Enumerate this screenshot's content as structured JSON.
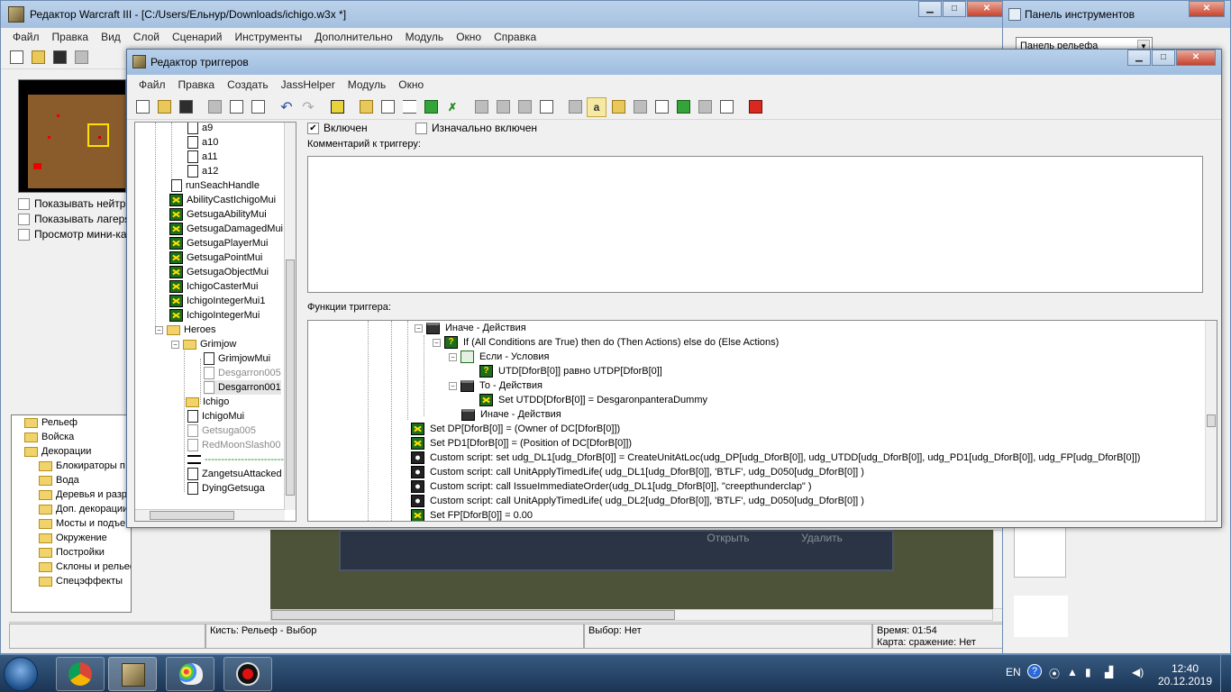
{
  "main_window": {
    "title": "Редактор Warcraft III  - [C:/Users/Ельнур/Downloads/ichigo.w3x *]",
    "menu": [
      "Файл",
      "Правка",
      "Вид",
      "Слой",
      "Сценарий",
      "Инструменты",
      "Дополнительно",
      "Модуль",
      "Окно",
      "Справка"
    ],
    "checkboxes": [
      "Показывать нейтра",
      "Показывать лагеря",
      "Просмотр мини-кар"
    ],
    "palette": [
      "Рельеф",
      "Войска",
      "Декорации",
      "Блокираторы п",
      "Вода",
      "Деревья и разр",
      "Доп. декорации",
      "Мосты и подъе",
      "Окружение",
      "Постройки",
      "Склоны и рельеф",
      "Спецэффекты"
    ],
    "terrain_buttons": [
      "Открыть",
      "Удалить"
    ],
    "status": {
      "brush": "Кисть: Рельеф - Выбор",
      "selection": "Выбор: Нет",
      "time": "Время: 01:54",
      "map": "Карта: сражение: Нет"
    }
  },
  "tool_window": {
    "title": "Панель инструментов",
    "dropdown": "Панель рельефа"
  },
  "trigger_editor": {
    "title": "Редактор триггеров",
    "menu": [
      "Файл",
      "Правка",
      "Создать",
      "JassHelper",
      "Модуль",
      "Окно"
    ],
    "enabled_label": "Включен",
    "initially_on_label": "Изначально включен",
    "comment_label": "Комментарий к триггеру:",
    "functions_label": "Функции триггера:",
    "tree": [
      {
        "label": "a9",
        "icon": "doc",
        "gray": false
      },
      {
        "label": "a10",
        "icon": "doc",
        "gray": false
      },
      {
        "label": "a11",
        "icon": "doc",
        "gray": false
      },
      {
        "label": "a12",
        "icon": "doc",
        "gray": false
      },
      {
        "label": "runSeachHandle",
        "icon": "doc",
        "gray": false
      },
      {
        "label": "AbilityCastIchigoMui",
        "icon": "var",
        "gray": false
      },
      {
        "label": "GetsugaAbilityMui",
        "icon": "var",
        "gray": false
      },
      {
        "label": "GetsugaDamagedMui",
        "icon": "var",
        "gray": false
      },
      {
        "label": "GetsugaPlayerMui",
        "icon": "var",
        "gray": false
      },
      {
        "label": "GetsugaPointMui",
        "icon": "var",
        "gray": false
      },
      {
        "label": "GetsugaObjectMui",
        "icon": "var",
        "gray": false
      },
      {
        "label": "IchigoCasterMui",
        "icon": "var",
        "gray": false
      },
      {
        "label": "IchigoIntegerMui1",
        "icon": "var",
        "gray": false
      },
      {
        "label": "IchigoIntegerMui",
        "icon": "var",
        "gray": false
      },
      {
        "label": "Heroes",
        "icon": "folder",
        "gray": false
      },
      {
        "label": "Grimjow",
        "icon": "folder",
        "gray": false
      },
      {
        "label": "GrimjowMui",
        "icon": "doc",
        "gray": false
      },
      {
        "label": "Desgarron005",
        "icon": "doc",
        "gray": true
      },
      {
        "label": "Desgarron001",
        "icon": "doc",
        "gray": false
      },
      {
        "label": "Ichigo",
        "icon": "folder",
        "gray": false
      },
      {
        "label": "IchigoMui",
        "icon": "doc",
        "gray": false
      },
      {
        "label": "Getsuga005",
        "icon": "doc",
        "gray": true
      },
      {
        "label": "RedMoonSlash00",
        "icon": "doc",
        "gray": true
      },
      {
        "label": "-----------------------------",
        "icon": "comment",
        "gray": false
      },
      {
        "label": "ZangetsuAttacked",
        "icon": "doc",
        "gray": false
      },
      {
        "label": "DyingGetsuga",
        "icon": "doc",
        "gray": false
      }
    ],
    "functions": [
      {
        "text": "Иначе - Действия",
        "icon": "clap"
      },
      {
        "text": "If (All Conditions are True) then do (Then Actions) else do (Else Actions)",
        "icon": "cond"
      },
      {
        "text": "Если - Условия",
        "icon": "condhead"
      },
      {
        "text": "UTD[DforB[0]] равно UTDP[DforB[0]]",
        "icon": "cond"
      },
      {
        "text": "То - Действия",
        "icon": "clap"
      },
      {
        "text": "Set UTDD[DforB[0]] = DesgaronpanteraDummy",
        "icon": "act"
      },
      {
        "text": "Иначе - Действия",
        "icon": "clap"
      },
      {
        "text": "Set DP[DforB[0]] = (Owner of DC[DforB[0]])",
        "icon": "act"
      },
      {
        "text": "Set PD1[DforB[0]] = (Position of DC[DforB[0]])",
        "icon": "act"
      },
      {
        "text": "Custom script:   set udg_DL1[udg_DforB[0]] = CreateUnitAtLoc(udg_DP[udg_DforB[0]], udg_UTDD[udg_DforB[0]], udg_PD1[udg_DforB[0]], udg_FP[udg_DforB[0]])",
        "icon": "script"
      },
      {
        "text": "Custom script:   call UnitApplyTimedLife( udg_DL1[udg_DforB[0]], 'BTLF', udg_D050[udg_DforB[0]]  )",
        "icon": "script"
      },
      {
        "text": "Custom script:   call IssueImmediateOrder(udg_DL1[udg_DforB[0]], \"creepthunderclap\" )",
        "icon": "script"
      },
      {
        "text": "Custom script:   call UnitApplyTimedLife( udg_DL2[udg_DforB[0]], 'BTLF', udg_D050[udg_DforB[0]]  )",
        "icon": "script"
      },
      {
        "text": "Set FP[DforB[0]] = 0.00",
        "icon": "act"
      }
    ]
  },
  "taskbar": {
    "lang": "EN",
    "time": "12:40",
    "date": "20.12.2019"
  }
}
